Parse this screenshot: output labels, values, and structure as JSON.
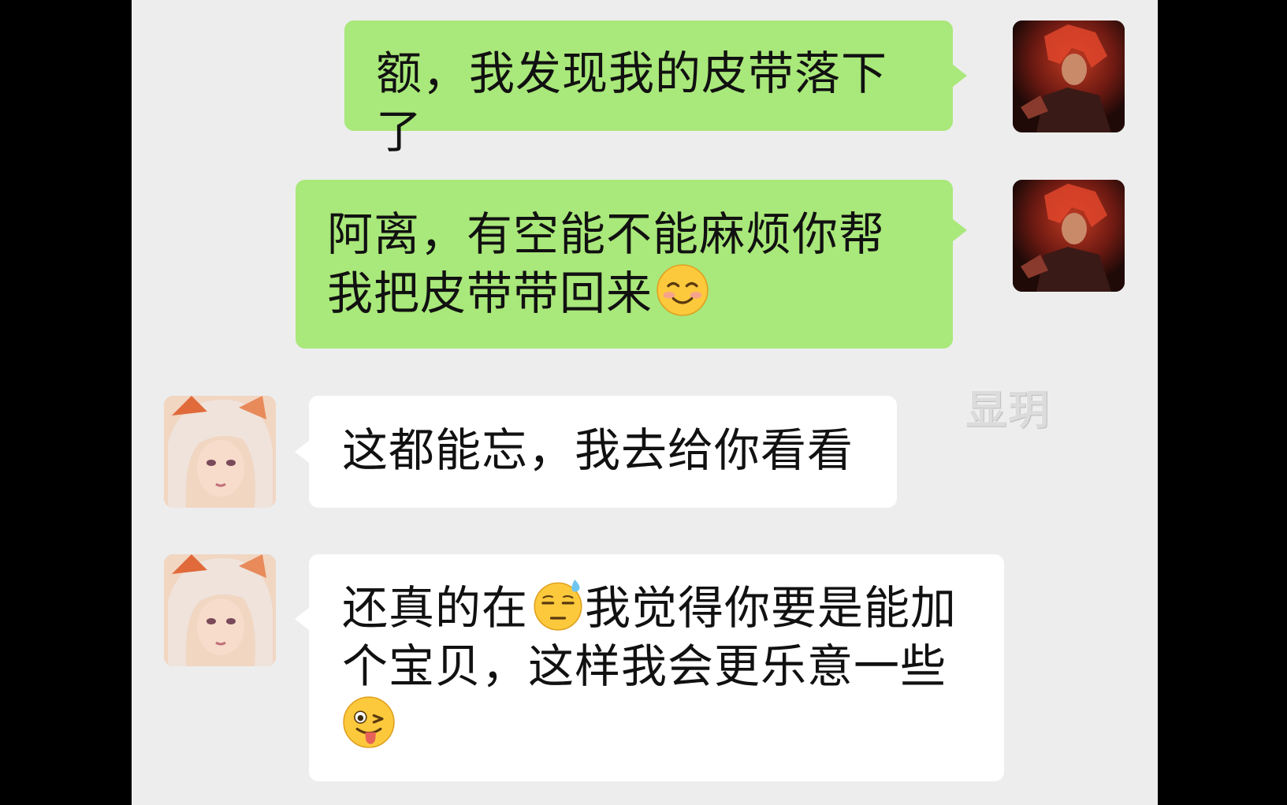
{
  "watermark": "显玥",
  "messages": [
    {
      "side": "out",
      "avatar_icon": "red-haired-warrior-avatar",
      "text": "额，我发现我的皮带落下了"
    },
    {
      "side": "out",
      "avatar_icon": "red-haired-warrior-avatar",
      "text": "阿离，有空能不能麻烦你帮我把皮带带回来",
      "emoji": "smiling-blush-emoji"
    },
    {
      "side": "in",
      "avatar_icon": "pink-haired-girl-avatar",
      "text": "这都能忘，我去给你看看"
    },
    {
      "side": "in",
      "avatar_icon": "pink-haired-girl-avatar",
      "text_before_emoji": "还真的在",
      "emoji_1": "sweat-smile-emoji",
      "text_after_emoji": "我觉得你要是能加个宝贝，这样我会更乐意一些",
      "emoji_2": "winking-tongue-emoji"
    }
  ],
  "colors": {
    "outgoing_bubble": "#a9e87a",
    "incoming_bubble": "#ffffff",
    "chat_background": "#ededed"
  }
}
